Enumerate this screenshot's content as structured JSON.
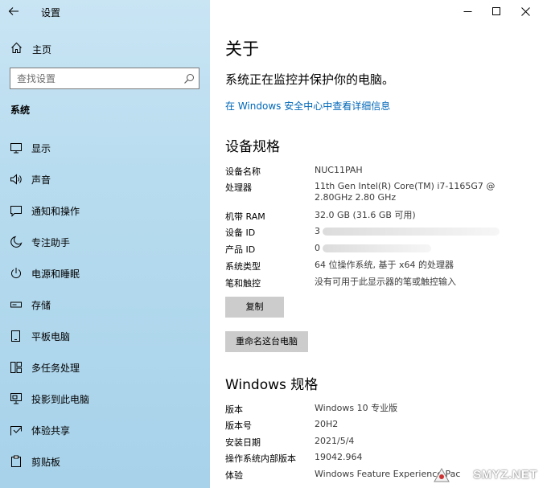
{
  "app": {
    "title": "设置"
  },
  "sidebar": {
    "home_label": "主页",
    "search_placeholder": "查找设置",
    "section": "系统",
    "items": [
      {
        "label": "显示",
        "icon": "display-icon"
      },
      {
        "label": "声音",
        "icon": "sound-icon"
      },
      {
        "label": "通知和操作",
        "icon": "notifications-icon"
      },
      {
        "label": "专注助手",
        "icon": "focus-assist-icon"
      },
      {
        "label": "电源和睡眠",
        "icon": "power-icon"
      },
      {
        "label": "存储",
        "icon": "storage-icon"
      },
      {
        "label": "平板电脑",
        "icon": "tablet-icon"
      },
      {
        "label": "多任务处理",
        "icon": "multitasking-icon"
      },
      {
        "label": "投影到此电脑",
        "icon": "projecting-icon"
      },
      {
        "label": "体验共享",
        "icon": "shared-experiences-icon"
      },
      {
        "label": "剪贴板",
        "icon": "clipboard-icon"
      }
    ]
  },
  "main": {
    "title": "关于",
    "subtitle": "系统正在监控并保护你的电脑。",
    "link": "在 Windows 安全中心中查看详细信息",
    "device_spec_title": "设备规格",
    "device_specs": [
      {
        "key": "设备名称",
        "value": "NUC11PAH"
      },
      {
        "key": "处理器",
        "value": "11th Gen Intel(R) Core(TM) i7-1165G7 @ 2.80GHz 2.80 GHz"
      },
      {
        "key": "机带 RAM",
        "value": "32.0 GB (31.6 GB 可用)"
      },
      {
        "key": "设备 ID",
        "value": "3"
      },
      {
        "key": "产品 ID",
        "value": "0"
      },
      {
        "key": "系统类型",
        "value": "64 位操作系统, 基于 x64 的处理器"
      },
      {
        "key": "笔和触控",
        "value": "没有可用于此显示器的笔或触控输入"
      }
    ],
    "copy_button": "复制",
    "rename_button": "重命名这台电脑",
    "windows_spec_title": "Windows 规格",
    "windows_specs": [
      {
        "key": "版本",
        "value": "Windows 10 专业版"
      },
      {
        "key": "版本号",
        "value": "20H2"
      },
      {
        "key": "安装日期",
        "value": "2021/5/4"
      },
      {
        "key": "操作系统内部版本",
        "value": "19042.964"
      },
      {
        "key": "体验",
        "value": "Windows Feature Experience Pac"
      }
    ]
  },
  "watermark": "SMYZ.NET",
  "colors": {
    "link": "#0067b8",
    "button": "#cccccc",
    "sidebar": "#b8dcef"
  }
}
